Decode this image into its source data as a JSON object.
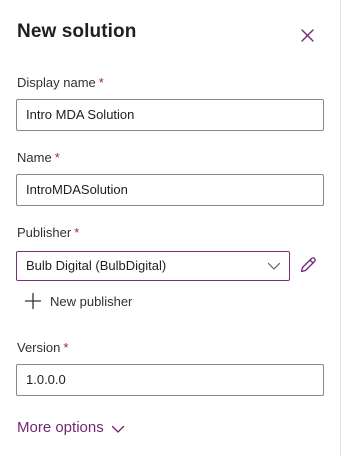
{
  "panel": {
    "title": "New solution",
    "close_icon": "close-icon"
  },
  "colors": {
    "accent": "#742774",
    "required": "#a4262c",
    "border": "#8a8886",
    "text": "#201f1e"
  },
  "form": {
    "display_name": {
      "label": "Display name",
      "required_mark": "*",
      "value": "Intro MDA Solution"
    },
    "name": {
      "label": "Name",
      "required_mark": "*",
      "value": "IntroMDASolution"
    },
    "publisher": {
      "label": "Publisher",
      "required_mark": "*",
      "selected": "Bulb Digital (BulbDigital)",
      "chevron_icon": "chevron-down-icon",
      "edit_icon": "pencil-icon",
      "new_publisher_label": "New publisher",
      "new_publisher_icon": "plus-icon"
    },
    "version": {
      "label": "Version",
      "required_mark": "*",
      "value": "1.0.0.0"
    },
    "more_options": {
      "label": "More options",
      "icon": "chevron-down-icon"
    }
  }
}
